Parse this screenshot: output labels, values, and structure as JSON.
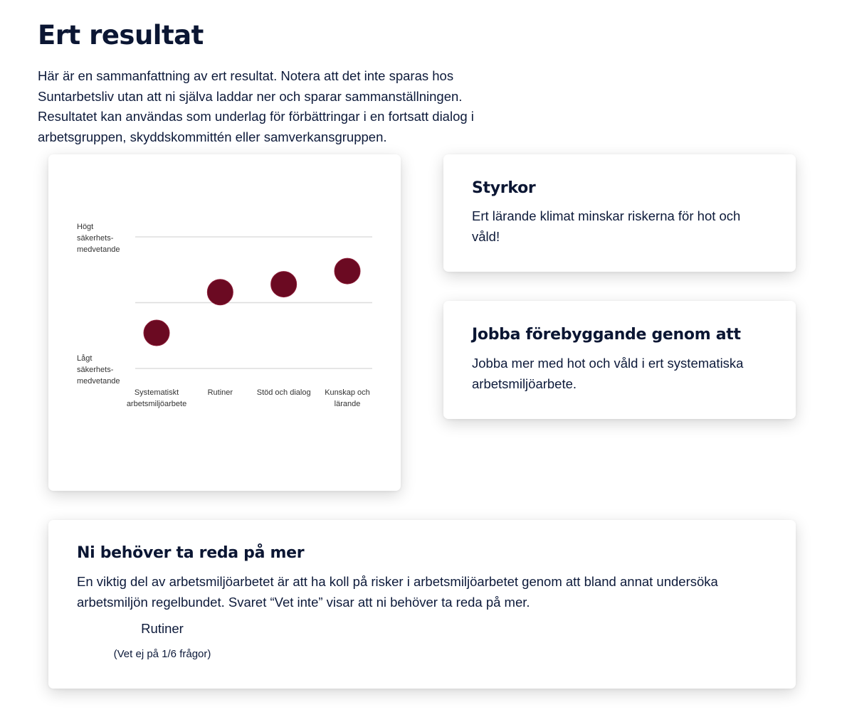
{
  "page": {
    "title": "Ert resultat",
    "intro": "Här är en sammanfattning av ert resultat. Notera att det inte sparas hos Suntarbetsliv utan att ni själva laddar ner och sparar sammanställningen. Resultatet kan användas som underlag för förbättringar i en fortsatt dialog i arbetsgruppen, skyddskommittén eller samverkansgruppen."
  },
  "strengths": {
    "heading": "Styrkor",
    "text": "Ert lärande klimat minskar riskerna för hot och våld!"
  },
  "prevent": {
    "heading": "Jobba förebyggande genom att",
    "text": "Jobba mer med hot och våld i ert systematiska arbetsmiljöarbete."
  },
  "more": {
    "heading": "Ni behöver ta reda på mer",
    "text": "En viktig del av arbetsmiljöarbetet är att ha koll på risker i arbetsmiljöarbetet genom att bland annat undersöka arbetsmiljön regelbundet. Svaret “Vet inte” visar att ni behöver ta reda på mer.",
    "area": "Rutiner",
    "note": "(Vet ej på 1/6 frågor)"
  },
  "chart_data": {
    "type": "scatter",
    "categories": [
      "Systematiskt arbetsmiljöarbete",
      "Rutiner",
      "Stöd och dialog",
      "Kunskap och lärande"
    ],
    "category_lines": [
      [
        "Systematiskt",
        "arbetsmiljöarbete"
      ],
      [
        "Rutiner"
      ],
      [
        "Stöd och dialog"
      ],
      [
        "Kunskap och",
        "lärande"
      ]
    ],
    "values": [
      0.27,
      0.58,
      0.64,
      0.74
    ],
    "ylim": [
      0,
      1
    ],
    "y_ticks": [
      {
        "value": 1,
        "lines": [
          "Högt",
          "säkerhets-",
          "medvetande"
        ]
      },
      {
        "value": 0,
        "lines": [
          "Lågt",
          "säkerhets-",
          "medvetande"
        ]
      }
    ],
    "grid_values": [
      0,
      0.5,
      1
    ],
    "marker_color": "#6b0a22",
    "grid_color": "#dddddd"
  }
}
